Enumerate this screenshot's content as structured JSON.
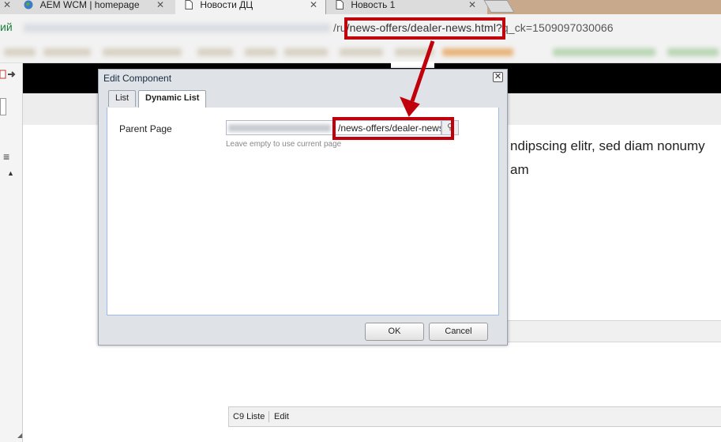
{
  "browser": {
    "tabs": [
      {
        "label": "AEM WCM | homepage",
        "icon": "globe-icon"
      },
      {
        "label": "Новости ДЦ",
        "icon": "page-icon"
      },
      {
        "label": "Новость 1",
        "icon": "page-icon"
      }
    ],
    "tab_close_glyph": "✕",
    "address_left": "ий",
    "url_prefix": "/ru",
    "url_highlight": "/news-offers/dealer-news.html?",
    "url_suffix": "q_ck=1509097030066"
  },
  "page": {
    "text_line1": "ndipscing elitr, sed diam nonumy",
    "text_line2": "am",
    "editbar": {
      "component": "C9 Liste",
      "edit": "Edit"
    }
  },
  "dialog": {
    "title": "Edit Component",
    "tabs": [
      "List",
      "Dynamic List"
    ],
    "field_label": "Parent Page",
    "field_value": "/news-offers/dealer-news",
    "field_hint": "Leave empty to use current page",
    "ok_label": "OK",
    "cancel_label": "Cancel"
  },
  "colors": {
    "highlight": "#c0000b",
    "black_bar": "#000000",
    "dialog_bg": "#dfe3e8"
  }
}
